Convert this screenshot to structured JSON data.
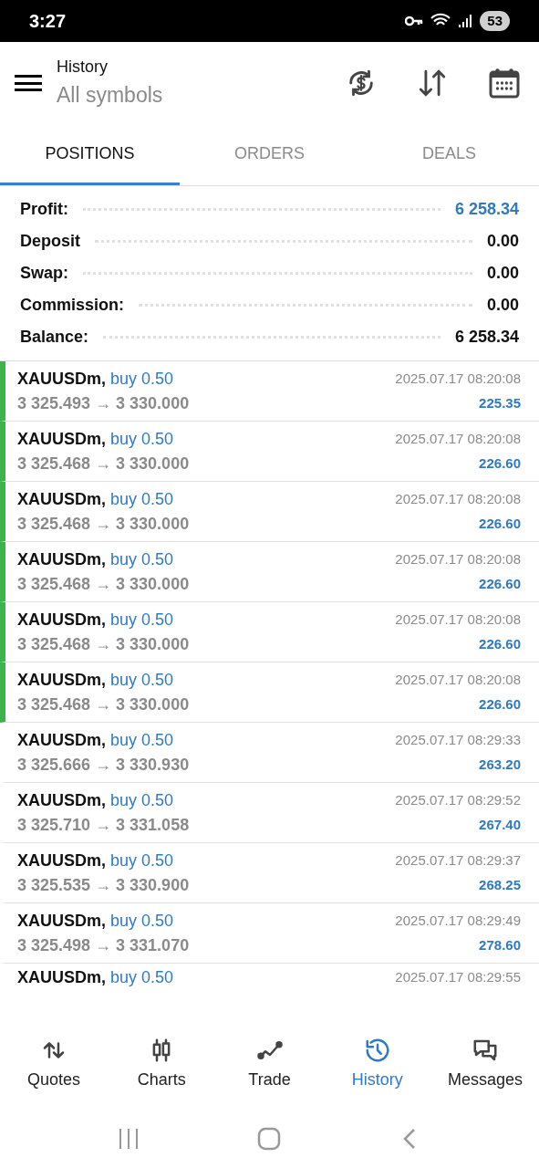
{
  "status_bar": {
    "time": "3:27",
    "battery": "53"
  },
  "header": {
    "title": "History",
    "subtitle": "All symbols"
  },
  "tabs": [
    {
      "label": "POSITIONS",
      "selected": true
    },
    {
      "label": "ORDERS",
      "selected": false
    },
    {
      "label": "DEALS",
      "selected": false
    }
  ],
  "summary": [
    {
      "label": "Profit:",
      "value": "6 258.34",
      "accent": true
    },
    {
      "label": "Deposit",
      "value": "0.00",
      "accent": false
    },
    {
      "label": "Swap:",
      "value": "0.00",
      "accent": false
    },
    {
      "label": "Commission:",
      "value": "0.00",
      "accent": false
    },
    {
      "label": "Balance:",
      "value": "6 258.34",
      "accent": false
    }
  ],
  "positions": [
    {
      "symbol": "XAUUSDm,",
      "side": "buy 0.50",
      "prices": "3 325.493 → 3 330.000",
      "time": "2025.07.17 08:20:08",
      "profit": "225.35",
      "marked": true
    },
    {
      "symbol": "XAUUSDm,",
      "side": "buy 0.50",
      "prices": "3 325.468 → 3 330.000",
      "time": "2025.07.17 08:20:08",
      "profit": "226.60",
      "marked": true
    },
    {
      "symbol": "XAUUSDm,",
      "side": "buy 0.50",
      "prices": "3 325.468 → 3 330.000",
      "time": "2025.07.17 08:20:08",
      "profit": "226.60",
      "marked": true
    },
    {
      "symbol": "XAUUSDm,",
      "side": "buy 0.50",
      "prices": "3 325.468 → 3 330.000",
      "time": "2025.07.17 08:20:08",
      "profit": "226.60",
      "marked": true
    },
    {
      "symbol": "XAUUSDm,",
      "side": "buy 0.50",
      "prices": "3 325.468 → 3 330.000",
      "time": "2025.07.17 08:20:08",
      "profit": "226.60",
      "marked": true
    },
    {
      "symbol": "XAUUSDm,",
      "side": "buy 0.50",
      "prices": "3 325.468 → 3 330.000",
      "time": "2025.07.17 08:20:08",
      "profit": "226.60",
      "marked": true
    },
    {
      "symbol": "XAUUSDm,",
      "side": "buy 0.50",
      "prices": "3 325.666 → 3 330.930",
      "time": "2025.07.17 08:29:33",
      "profit": "263.20",
      "marked": false
    },
    {
      "symbol": "XAUUSDm,",
      "side": "buy 0.50",
      "prices": "3 325.710 → 3 331.058",
      "time": "2025.07.17 08:29:52",
      "profit": "267.40",
      "marked": false
    },
    {
      "symbol": "XAUUSDm,",
      "side": "buy 0.50",
      "prices": "3 325.535 → 3 330.900",
      "time": "2025.07.17 08:29:37",
      "profit": "268.25",
      "marked": false
    },
    {
      "symbol": "XAUUSDm,",
      "side": "buy 0.50",
      "prices": "3 325.498 → 3 331.070",
      "time": "2025.07.17 08:29:49",
      "profit": "278.60",
      "marked": false
    },
    {
      "symbol": "XAUUSDm,",
      "side": "buy 0.50",
      "time": "2025.07.17 08:29:55",
      "marked": false
    }
  ],
  "bottom_nav": [
    {
      "label": "Quotes",
      "selected": false
    },
    {
      "label": "Charts",
      "selected": false
    },
    {
      "label": "Trade",
      "selected": false
    },
    {
      "label": "History",
      "selected": true
    },
    {
      "label": "Messages",
      "selected": false
    }
  ]
}
